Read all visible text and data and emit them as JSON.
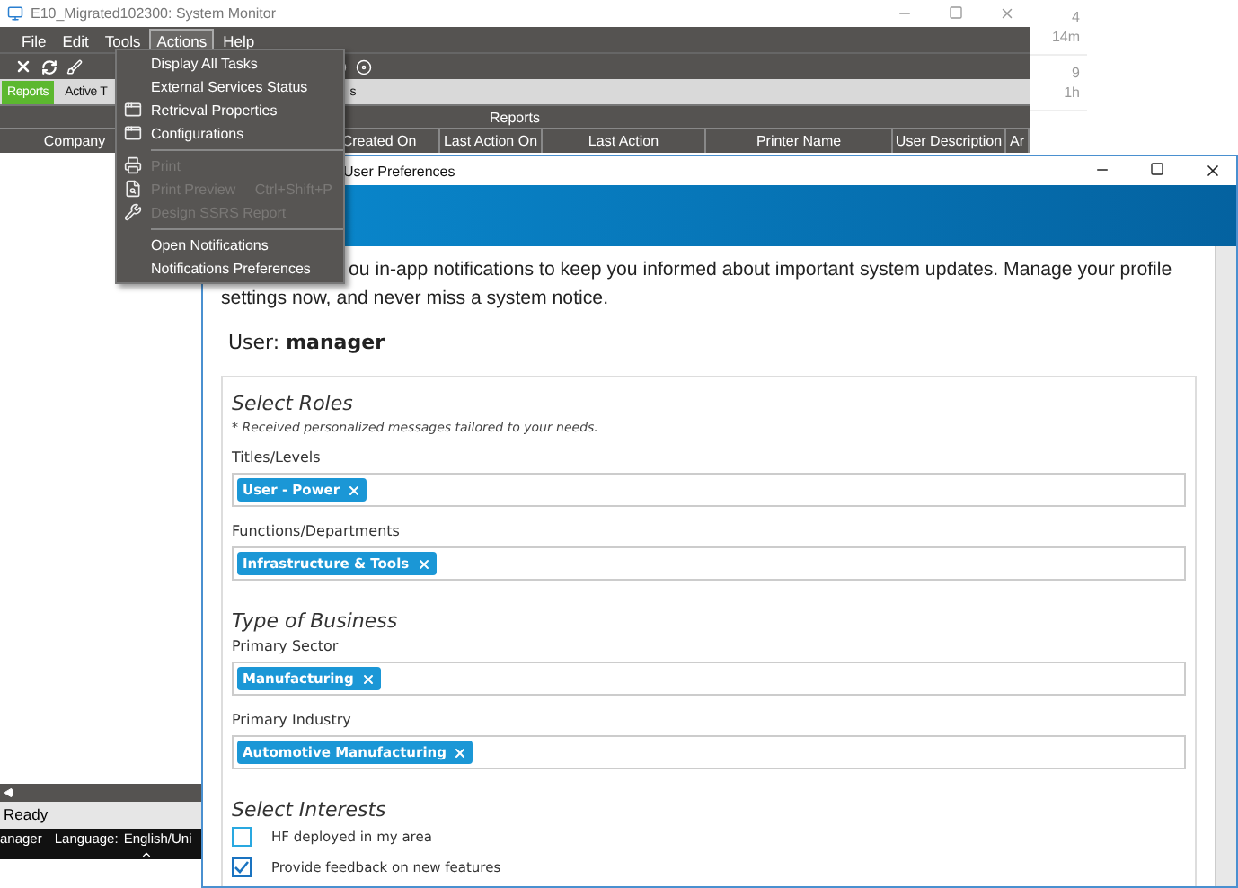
{
  "monitor": {
    "title": "E10_Migrated102300: System Monitor",
    "menu": [
      {
        "label": "File",
        "selected": false
      },
      {
        "label": "Edit",
        "selected": false
      },
      {
        "label": "Tools",
        "selected": false
      },
      {
        "label": "Actions",
        "selected": true
      },
      {
        "label": "Help",
        "selected": false
      }
    ],
    "tabs": [
      {
        "label": "Reports",
        "selected": true
      },
      {
        "label": "Active T",
        "selected": false
      },
      {
        "label": "s",
        "selected": false
      }
    ],
    "band_title": "Reports",
    "columns": [
      "Company",
      "",
      "Created On",
      "Last Action On",
      "Last Action",
      "Printer Name",
      "User Description",
      "Ar"
    ],
    "status": "Ready",
    "footer": [
      "anager",
      "Language:",
      "English/Uni"
    ]
  },
  "side_list": [
    {
      "count": "4",
      "age": "14m"
    },
    {
      "count": "9",
      "age": "1h"
    }
  ],
  "actions_menu": [
    [
      {
        "label": "Display All Tasks",
        "disabled": false
      },
      {
        "label": "External Services Status",
        "disabled": false
      },
      {
        "label": "Retrieval  Properties",
        "disabled": false
      },
      {
        "label": "Configurations",
        "disabled": false
      }
    ],
    [
      {
        "label": "Print",
        "disabled": true
      },
      {
        "label": "Print Preview",
        "shortcut": "Ctrl+Shift+P",
        "disabled": true
      },
      {
        "label": "Design SSRS Report",
        "disabled": true
      }
    ],
    [
      {
        "label": "Open Notifications",
        "disabled": false
      },
      {
        "label": "Notifications Preferences",
        "disabled": false
      }
    ]
  ],
  "dialog": {
    "title": "User Preferences",
    "intro": [
      "ou in-app notifications to keep you informed about important system updates. Manage your profile",
      "settings now, and never miss a system notice."
    ],
    "user": "User: **manager**",
    "sections": [
      {
        "title": "Select Roles",
        "note": "* Received personalized messages tailored to your needs.",
        "fields": [
          {
            "label": "Titles/Levels",
            "tags": [
              "User - Power"
            ]
          },
          {
            "label": "Functions/Departments",
            "tags": [
              "Infrastructure & Tools"
            ]
          }
        ]
      },
      {
        "title": "Type of Business",
        "fields": [
          {
            "label": "Primary Sector",
            "tags": [
              "Manufacturing"
            ]
          },
          {
            "label": "Primary Industry",
            "tags": [
              "Automotive Manufacturing"
            ]
          }
        ]
      },
      {
        "title": "Select Interests",
        "options": [
          {
            "label": "HF deployed in my area",
            "checked": false
          },
          {
            "label": "Provide feedback on new features",
            "checked": true
          }
        ]
      }
    ]
  }
}
